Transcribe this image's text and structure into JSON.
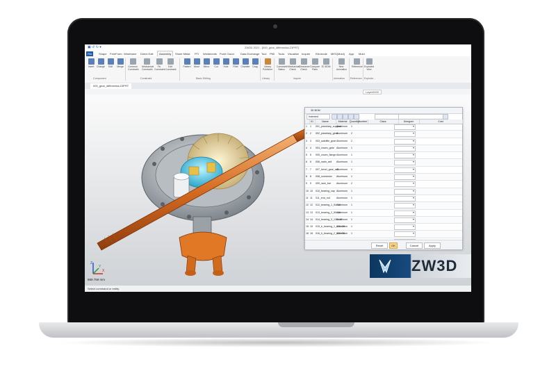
{
  "window": {
    "title": "ZW3D 2021 - [000_gear_differential.Z3PRT]",
    "quick_access": "▣ ↺ ↻ ▾"
  },
  "ribbon_tabs": [
    "File",
    "Shape",
    "FreeForm",
    "Wireframe",
    "Direct Edit",
    "Assembly",
    "Sheet Metal",
    "PTI",
    "Weldments",
    "Point Cloud",
    "Data Exchange",
    "Tool",
    "PMI",
    "Tools",
    "Visualize",
    "Inquire",
    "Electrode",
    "MES(Mold)",
    "App",
    "Mold"
  ],
  "ribbon_buttons": [
    {
      "label": "Insert",
      "color": "b"
    },
    {
      "label": "Change",
      "color": "b"
    },
    {
      "label": "Edit",
      "color": "b"
    },
    {
      "label": "Merge",
      "color": "b"
    },
    {
      "label": "Common Constraint",
      "color": "g"
    },
    {
      "label": "Mechanical Constraint",
      "color": "g"
    },
    {
      "label": "Fix Constraint",
      "color": "g"
    },
    {
      "label": "Edit Constraint",
      "color": "g"
    },
    {
      "label": "Pattern",
      "color": "b"
    },
    {
      "label": "Move",
      "color": "b"
    },
    {
      "label": "Mirror",
      "color": "b"
    },
    {
      "label": "Cut",
      "color": "b"
    },
    {
      "label": "Hole",
      "color": "b"
    },
    {
      "label": "Fillet",
      "color": "b"
    },
    {
      "label": "Chamfer",
      "color": "b"
    },
    {
      "label": "Drag",
      "color": "b"
    },
    {
      "label": "Library Publisher",
      "color": "o"
    },
    {
      "label": "Constraint Status",
      "color": "g"
    },
    {
      "label": "Mechanical Check",
      "color": "g"
    },
    {
      "label": "Clearance Check",
      "color": "g"
    },
    {
      "label": "Compare Parts",
      "color": "g"
    },
    {
      "label": "2D BOM",
      "color": "g"
    },
    {
      "label": "New Animation",
      "color": "g"
    },
    {
      "label": "Reference",
      "color": "g"
    },
    {
      "label": "Exploded View",
      "color": "g"
    }
  ],
  "ribbon_groups": [
    "Component",
    "Constraint",
    "Basic Editing",
    "Library",
    "Inquire",
    "Animation",
    "Reference",
    "Explode..."
  ],
  "document_tab": "000_gear_differential.Z3PRT",
  "layer_box": "Layer0000",
  "bom": {
    "title": "3D BOM",
    "mode": "Indented",
    "columns": [
      "",
      "ID",
      "Name",
      "Material",
      "Quantity",
      "Number",
      "Class",
      "Designer",
      "Cost"
    ],
    "rows": [
      {
        "sel": "1",
        "id": "1",
        "name": "001_planetary_support",
        "material": "Aluminum",
        "qty": "1"
      },
      {
        "sel": "2",
        "id": "2",
        "name": "002_planetary_gear",
        "material": "Aluminum",
        "qty": "2"
      },
      {
        "sel": "3",
        "id": "3",
        "name": "003_satellite_gear",
        "material": "Aluminum",
        "qty": "2"
      },
      {
        "sel": "4",
        "id": "4",
        "name": "004_crown_gear",
        "material": "Aluminum",
        "qty": "1"
      },
      {
        "sel": "5",
        "id": "5",
        "name": "005_crown_flange",
        "material": "Aluminum",
        "qty": "1"
      },
      {
        "sel": "6",
        "id": "6",
        "name": "006_main_axil",
        "material": "Aluminum",
        "qty": "1"
      },
      {
        "sel": "7",
        "id": "7",
        "name": "007_bevel_gear_axil",
        "material": "Aluminum",
        "qty": "1"
      },
      {
        "sel": "8",
        "id": "8",
        "name": "008_connector",
        "material": "Aluminum",
        "qty": "1"
      },
      {
        "sel": "9",
        "id": "9",
        "name": "009_rack_bar",
        "material": "Aluminum",
        "qty": "2"
      },
      {
        "sel": "10",
        "id": "10",
        "name": "010_bearing_cap",
        "material": "Aluminum",
        "qty": "1"
      },
      {
        "sel": "11",
        "id": "11",
        "name": "011_end_nut",
        "material": "Aluminum",
        "qty": "1"
      },
      {
        "sel": "12",
        "id": "12",
        "name": "012_bearing_1_54×16",
        "material": "Aluminum",
        "qty": "1"
      },
      {
        "sel": "13",
        "id": "13",
        "name": "013_bearing_2_50×16",
        "material": "Aluminum",
        "qty": "1"
      },
      {
        "sel": "14",
        "id": "14",
        "name": "014_bearing_3_120×16",
        "material": "Aluminum",
        "qty": "1"
      },
      {
        "sel": "15",
        "id": "15",
        "name": "015_b_bearing_1_120×30",
        "material": "Aluminum",
        "qty": "1"
      },
      {
        "sel": "16",
        "id": "16",
        "name": "016_b_bearing_2_120×30",
        "material": "Aluminum",
        "qty": "1"
      },
      {
        "sel": "17",
        "id": "17",
        "name": "017_sealing_ring",
        "material": "Aluminum",
        "qty": "1"
      }
    ],
    "buttons": {
      "reset": "Reset",
      "ok": "OK",
      "cancel": "Cancel",
      "apply": "Apply"
    }
  },
  "viewport": {
    "scale_text": "889.759 mm",
    "triad_labels": {
      "x": "X",
      "y": "Y",
      "z": "Z"
    }
  },
  "status": {
    "message": "Select command or entity."
  },
  "brand": {
    "text": "ZW3D",
    "primary": "#174a7e"
  }
}
